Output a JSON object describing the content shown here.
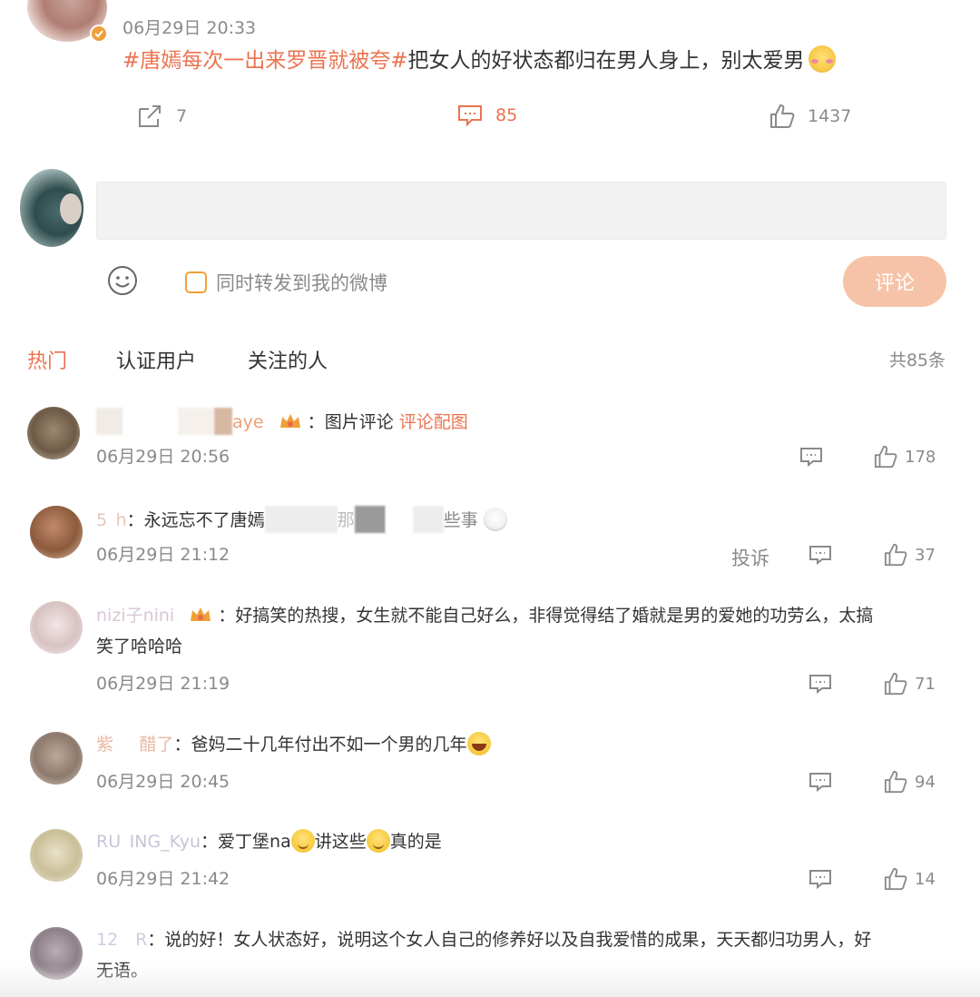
{
  "post": {
    "time": "06月29日 20:33",
    "topic": "#唐嫣每次一出来罗晋就被夸#",
    "text": "把女人的好状态都归在男人身上，别太爱男",
    "reposts": "7",
    "comments": "85",
    "likes": "1437"
  },
  "composer": {
    "repost_label": "同时转发到我的微博",
    "submit_label": "评论"
  },
  "tabs": {
    "hot": "热门",
    "verified": "认证用户",
    "followed": "关注的人",
    "total": "共85条"
  },
  "comments": [
    {
      "name": "aye",
      "sep": "：",
      "body": "图片评论",
      "link": "评论配图",
      "time": "06月29日 20:56",
      "likes": "178"
    },
    {
      "name": "5 h",
      "sep": "：",
      "body_a": "永远忘不了唐嫣",
      "body_b": "那",
      "body_c": "些事",
      "time": "06月29日 21:12",
      "report": "投诉",
      "likes": "37"
    },
    {
      "name": "nizi子nini",
      "sep": "：",
      "body_l1": "好搞笑的热搜，女生就不能自己好么，非得觉得结了婚就是男的爱她的功劳么，太搞",
      "body_l2": "笑了哈哈哈",
      "time": "06月29日 21:19",
      "likes": "71"
    },
    {
      "name": "紫   醋了",
      "sep": "：",
      "body": "爸妈二十几年付出不如一个男的几年",
      "time": "06月29日 20:45",
      "likes": "94"
    },
    {
      "name": "RU ING_Kyu",
      "sep": "：",
      "body_a": "爱丁堡na",
      "body_b": "讲这些",
      "body_c": "真的是",
      "time": "06月29日 21:42",
      "likes": "14"
    },
    {
      "name": "12  R",
      "sep": "：",
      "body_l1": "说的好！女人状态好，说明这个女人自己的修养好以及自我爱惜的成果，天天都归功男人，好",
      "body_l2": "无语。"
    }
  ],
  "colors": {
    "accent": "#eb7350",
    "submit_bg": "#f6c3a8",
    "muted_text": "#8a8a8a",
    "input_bg": "#f2f2f2"
  },
  "icons": [
    "repost-icon",
    "comment-icon",
    "like-icon",
    "emoji-icon",
    "checkbox-icon",
    "crown-badge-icon",
    "verified-badge-icon"
  ]
}
